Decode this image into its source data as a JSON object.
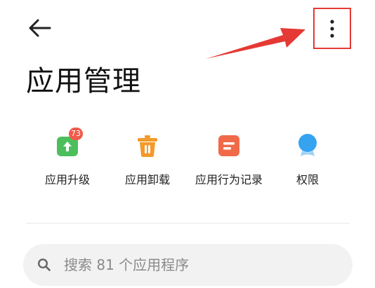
{
  "header": {
    "back_icon": "arrow-left-icon",
    "more_icon": "more-vertical-icon",
    "annotation_color": "#e53935"
  },
  "page": {
    "title": "应用管理"
  },
  "quick_actions": [
    {
      "label": "应用升级",
      "icon": "app-upgrade-icon",
      "color": "#4cbf5c",
      "badge": "73"
    },
    {
      "label": "应用卸载",
      "icon": "trash-icon",
      "color": "#f39a2a"
    },
    {
      "label": "应用行为记录",
      "icon": "behavior-record-icon",
      "color": "#f06a4a"
    },
    {
      "label": "权限",
      "icon": "permission-icon",
      "color": "#35a3f0"
    }
  ],
  "search": {
    "placeholder": "搜索 81 个应用程序",
    "icon": "search-icon"
  },
  "colors": {
    "badge": "#f05a4a",
    "search_bg": "#f2f2f2"
  }
}
